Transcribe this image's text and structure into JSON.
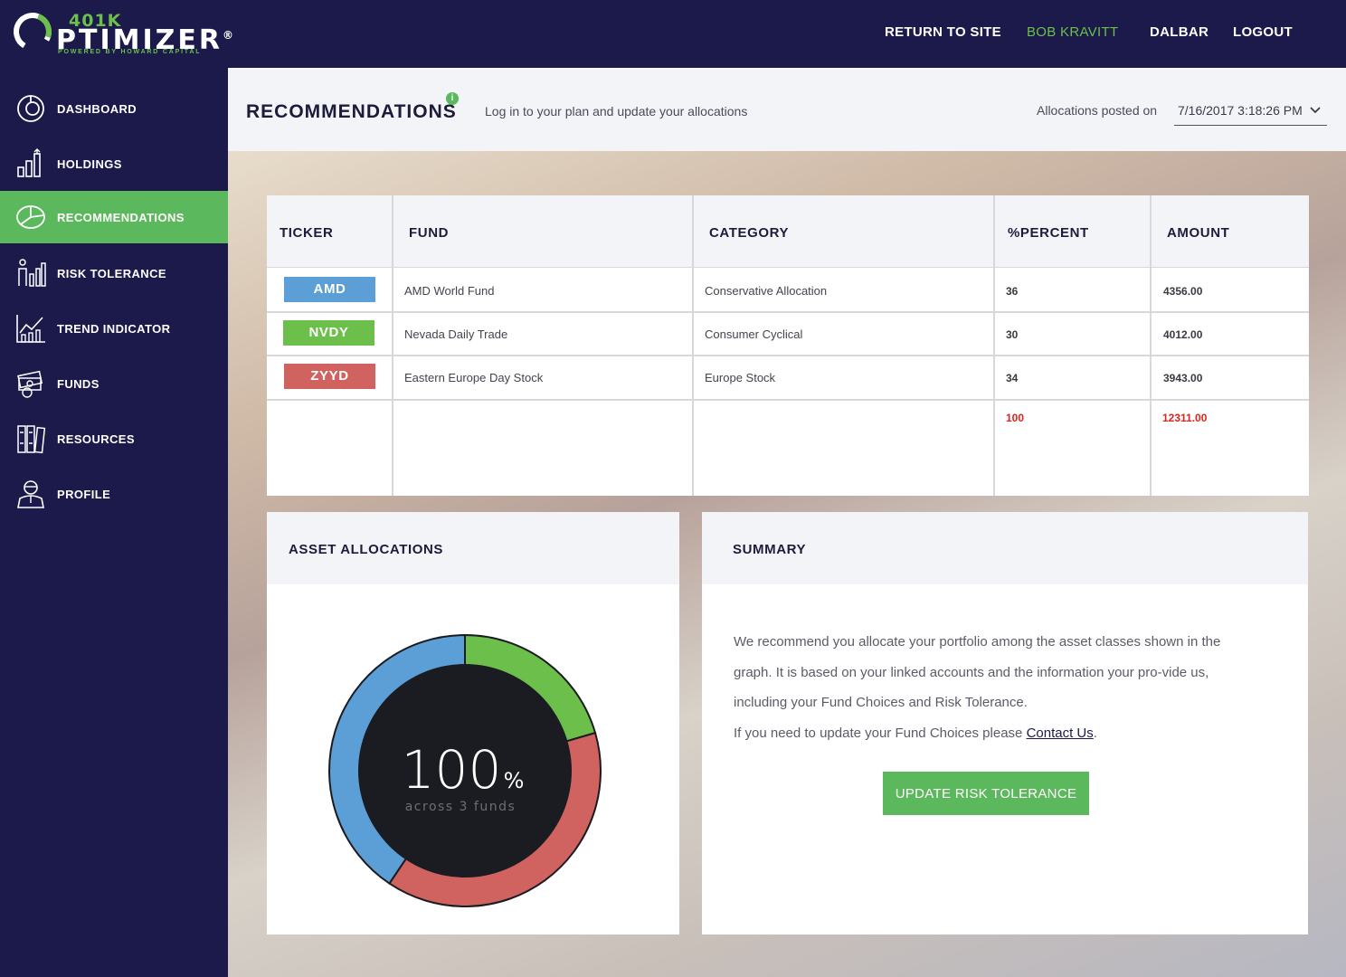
{
  "brand": {
    "line1": "401K",
    "line2": "PTIMIZER",
    "registered": "®",
    "tagline": "POWERED BY HOWARD CAPITAL"
  },
  "topnav": {
    "return_to_site": "RETURN TO SITE",
    "user": "BOB KRAVITT",
    "dalbar": "DALBAR",
    "logout": "LOGOUT"
  },
  "sidebar": {
    "items": [
      {
        "label": "DASHBOARD",
        "icon": "dashboard-icon"
      },
      {
        "label": "HOLDINGS",
        "icon": "holdings-icon"
      },
      {
        "label": "RECOMMENDATIONS",
        "icon": "pie-chart-icon",
        "active": true
      },
      {
        "label": "RISK TOLERANCE",
        "icon": "risk-icon"
      },
      {
        "label": "TREND INDICATOR",
        "icon": "trend-icon"
      },
      {
        "label": "FUNDS",
        "icon": "funds-icon"
      },
      {
        "label": "RESOURCES",
        "icon": "resources-icon"
      },
      {
        "label": "PROFILE",
        "icon": "profile-icon"
      }
    ]
  },
  "header": {
    "title": "RECOMMENDATIONS",
    "info": "i",
    "subtitle": "Log in to your plan and update your allocations",
    "posted_label": "Allocations posted on",
    "posted_value": "7/16/2017 3:18:26 PM"
  },
  "table": {
    "columns": [
      "TICKER",
      "FUND",
      "CATEGORY",
      "%PERCENT",
      "AMOUNT"
    ],
    "rows": [
      {
        "ticker": "AMD",
        "fund": "AMD World Fund",
        "category": "Conservative Allocation",
        "percent": "36",
        "amount": "4356.00",
        "color": "#5b9fd6"
      },
      {
        "ticker": "NVDY",
        "fund": "Nevada Daily Trade",
        "category": "Consumer Cyclical",
        "percent": "30",
        "amount": "4012.00",
        "color": "#6cbf4b"
      },
      {
        "ticker": "ZYYD",
        "fund": "Eastern Europe Day Stock",
        "category": "Europe Stock",
        "percent": "34",
        "amount": "3943.00",
        "color": "#d0625f"
      }
    ],
    "totals": {
      "percent": "100",
      "amount": "12311.00"
    }
  },
  "allocations": {
    "title": "ASSET ALLOCATIONS",
    "center_value": "100",
    "center_unit": "%",
    "center_caption": "across 3 funds"
  },
  "summary": {
    "title": "SUMMARY",
    "paragraph": "We recommend you allocate your portfolio among the asset classes shown in the graph. It is based on your linked accounts and the information your pro-vide us, including your Fund Choices and Risk Tolerance.",
    "cta_prefix": "If you need to update your Fund Choices please ",
    "cta_link": "Contact Us",
    "cta_suffix": ".",
    "button": "UPDATE RISK TOLERANCE"
  },
  "chart_data": {
    "type": "pie",
    "categories": [
      "NVDY",
      "ZYYD",
      "AMD"
    ],
    "values": [
      20.5,
      38.9,
      40.6
    ],
    "colors": [
      "#6cbf4b",
      "#d0625f",
      "#5b9fd6"
    ],
    "title": "ASSET ALLOCATIONS"
  }
}
